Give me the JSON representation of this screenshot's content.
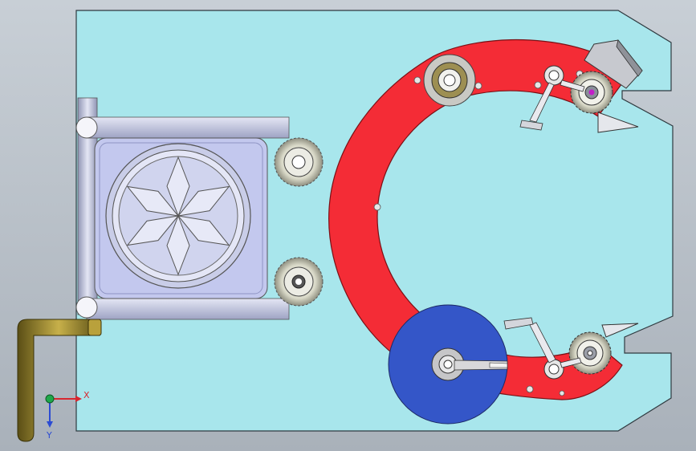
{
  "viewport": {
    "background_top": "#c8cfd6",
    "background_bottom": "#a9b1ba"
  },
  "colors": {
    "plate": "#a8e6ec",
    "plate_edge": "#2f3a40",
    "arc": "#f42c36",
    "arc_edge": "#7a1015",
    "drum": "#3456c8",
    "frame": "#c9cde8",
    "gear": "#d9d9c8",
    "handle": "#8a7a2a"
  },
  "triad": {
    "x_label": "X",
    "y_label": "Y",
    "x_color": "#d8272f",
    "y_color": "#2b4bd3",
    "origin_color": "#1fa84a"
  }
}
